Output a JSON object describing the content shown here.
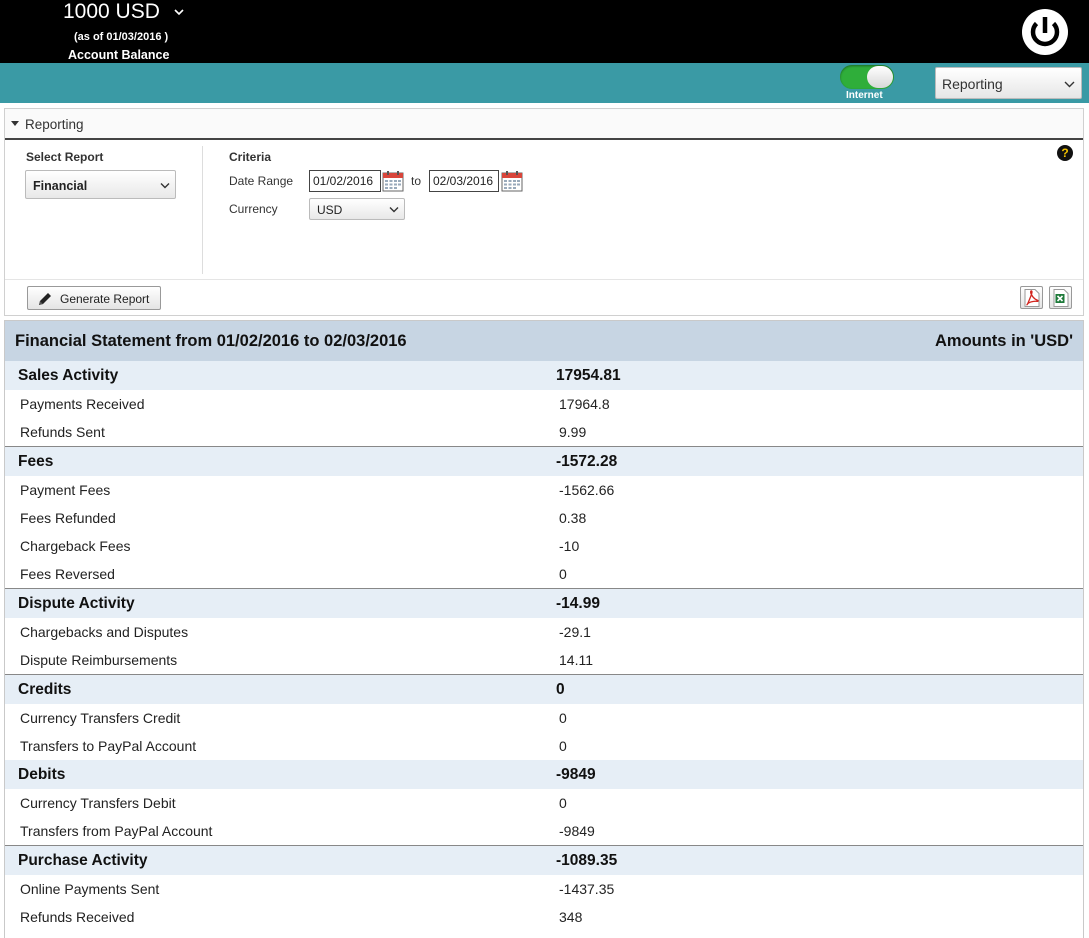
{
  "header": {
    "balance_amount": "1000 USD",
    "balance_as_of": "(as of 01/03/2016 )",
    "balance_label": "Account Balance",
    "power_icon": "power-icon"
  },
  "toolbar": {
    "internet_label": "Internet",
    "internet_on": true,
    "nav_select_value": "Reporting"
  },
  "reporting": {
    "panel_title": "Reporting",
    "select_report_label": "Select Report",
    "select_report_value": "Financial",
    "criteria_label": "Criteria",
    "date_range_label": "Date Range",
    "date_from": "01/02/2016",
    "date_to_label": "to",
    "date_to": "02/03/2016",
    "currency_label": "Currency",
    "currency_value": "USD",
    "help_glyph": "?",
    "generate_button": "Generate Report",
    "export_icons": [
      "pdf-icon",
      "excel-icon"
    ]
  },
  "statement": {
    "title": "Financial Statement from 01/02/2016 to 02/03/2016",
    "amounts_note": "Amounts in 'USD'",
    "sections": [
      {
        "label": "Sales Activity",
        "total": "17954.81",
        "items": [
          {
            "label": "Payments Received",
            "value": "17964.8"
          },
          {
            "label": "Refunds Sent",
            "value": "9.99"
          }
        ]
      },
      {
        "label": "Fees",
        "total": "-1572.28",
        "items": [
          {
            "label": "Payment Fees",
            "value": "-1562.66"
          },
          {
            "label": "Fees Refunded",
            "value": "0.38"
          },
          {
            "label": "Chargeback Fees",
            "value": "-10"
          },
          {
            "label": "Fees Reversed",
            "value": "0"
          }
        ]
      },
      {
        "label": "Dispute Activity",
        "total": "-14.99",
        "items": [
          {
            "label": "Chargebacks and Disputes",
            "value": "-29.1"
          },
          {
            "label": "Dispute Reimbursements",
            "value": "14.11"
          }
        ]
      },
      {
        "label": "Credits",
        "total": "0",
        "items": [
          {
            "label": "Currency Transfers Credit",
            "value": "0"
          },
          {
            "label": "Transfers to PayPal Account",
            "value": "0"
          }
        ]
      },
      {
        "label": "Debits",
        "total": "-9849",
        "items": [
          {
            "label": "Currency Transfers Debit",
            "value": "0"
          },
          {
            "label": "Transfers from PayPal Account",
            "value": "-9849"
          }
        ]
      },
      {
        "label": "Purchase Activity",
        "total": "-1089.35",
        "items": [
          {
            "label": "Online Payments Sent",
            "value": "-1437.35"
          },
          {
            "label": "Refunds Received",
            "value": "348"
          }
        ]
      }
    ]
  },
  "colors": {
    "topbar": "#000000",
    "tealbar": "#3a9aa5",
    "toggle_on": "#2fae3a",
    "statement_header": "#c7d5e3",
    "section_row": "#e6eef6"
  }
}
